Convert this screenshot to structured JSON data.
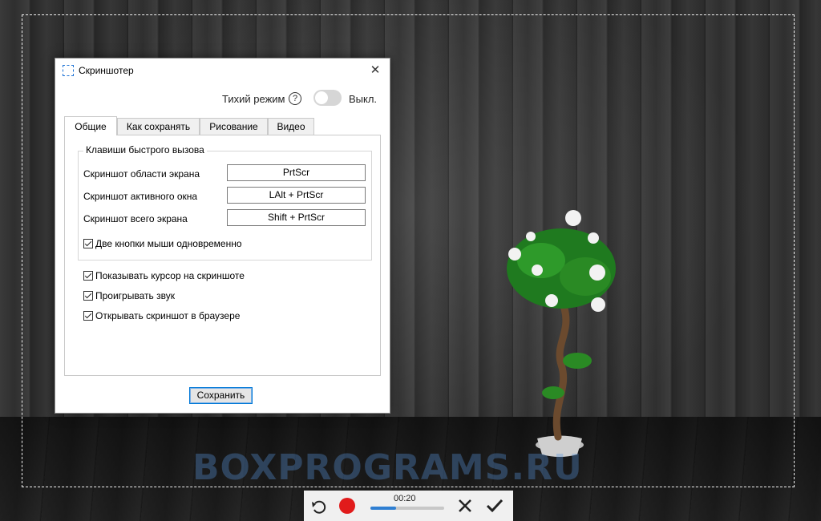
{
  "dialog": {
    "title": "Скриншотер",
    "close_glyph": "✕",
    "silent_mode": {
      "label": "Тихий режим",
      "help": "?",
      "toggle_on": false,
      "state_label": "Выкл."
    },
    "tabs": [
      {
        "label": "Общие",
        "active": true
      },
      {
        "label": "Как сохранять",
        "active": false
      },
      {
        "label": "Рисование",
        "active": false
      },
      {
        "label": "Видео",
        "active": false
      }
    ],
    "hotkeys": {
      "group_title": "Клавиши быстрого вызова",
      "rows": [
        {
          "label": "Скриншот области экрана",
          "value": "PrtScr"
        },
        {
          "label": "Скриншот активного окна",
          "value": "LAlt + PrtScr"
        },
        {
          "label": "Скриншот всего экрана",
          "value": "Shift + PrtScr"
        }
      ],
      "two_buttons": {
        "label": "Две кнопки мыши одновременно",
        "checked": true
      }
    },
    "options": [
      {
        "label": "Показывать курсор на скриншоте",
        "checked": true
      },
      {
        "label": "Проигрывать звук",
        "checked": true
      },
      {
        "label": "Открывать скриншот в браузере",
        "checked": true
      }
    ],
    "save_label": "Сохранить"
  },
  "toolbar": {
    "timer": "00:20",
    "progress": 0.35,
    "icons": [
      "undo-icon",
      "record-icon",
      "cancel-icon",
      "checkmark-icon"
    ],
    "record_color": "#e11b1b",
    "progress_color": "#2f7fd2"
  },
  "watermark": "BOXPROGRAMS.RU",
  "colors": {
    "accent": "#0078d7",
    "selection_border": "#f2f2f2"
  }
}
